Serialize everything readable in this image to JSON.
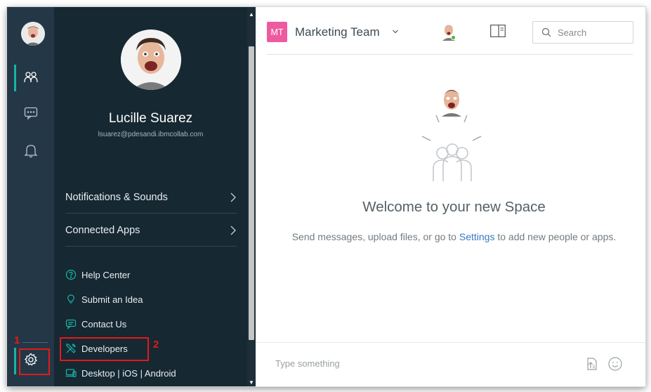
{
  "team": {
    "badge": "MT",
    "name": "Marketing Team"
  },
  "profile": {
    "name": "Lucille Suarez",
    "email": "lsuarez@pdesandi.ibmcollab.com"
  },
  "menu": [
    {
      "label": "Notifications & Sounds"
    },
    {
      "label": "Connected Apps"
    }
  ],
  "links": [
    {
      "label": "Help Center",
      "icon": "help-circle-icon"
    },
    {
      "label": "Submit an Idea",
      "icon": "lightbulb-icon"
    },
    {
      "label": "Contact Us",
      "icon": "chat-bubble-icon"
    },
    {
      "label": "Developers",
      "icon": "tools-icon"
    },
    {
      "label": "Desktop | iOS | Android",
      "icon": "devices-icon"
    }
  ],
  "search": {
    "placeholder": "Search"
  },
  "welcome": {
    "title": "Welcome to your new Space",
    "sub_before": "Send messages, upload files, or go to",
    "sub_link": "Settings",
    "sub_after": "to add new people or apps."
  },
  "composer": {
    "placeholder": "Type something"
  },
  "annotations": [
    {
      "label": "1"
    },
    {
      "label": "2"
    }
  ],
  "colors": {
    "rail": "#243746",
    "panel": "#162832",
    "accent": "#17b5a7",
    "team_badge": "#ee5aa0",
    "link": "#3b78c4",
    "annotation": "#e11b1b"
  }
}
